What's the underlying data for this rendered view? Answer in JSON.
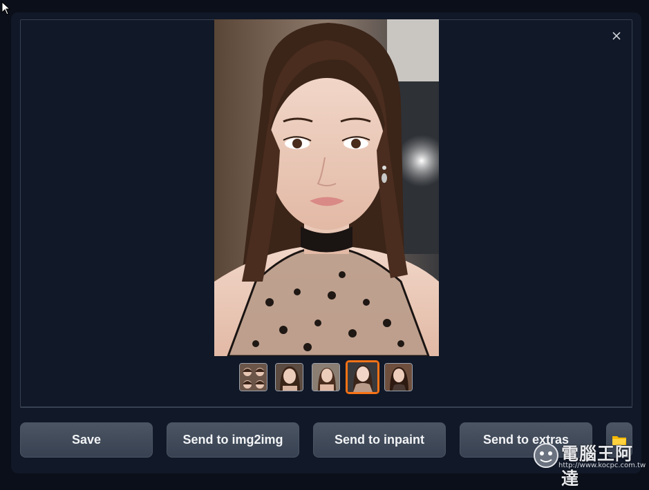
{
  "gallery": {
    "close_label": "close",
    "thumbnails": [
      {
        "name": "thumbnail-1",
        "selected": false
      },
      {
        "name": "thumbnail-2",
        "selected": false
      },
      {
        "name": "thumbnail-3",
        "selected": false
      },
      {
        "name": "thumbnail-4",
        "selected": true
      },
      {
        "name": "thumbnail-5",
        "selected": false
      }
    ]
  },
  "actions": {
    "save": "Save",
    "send_img2img": "Send to img2img",
    "send_inpaint": "Send to inpaint",
    "send_extras": "Send to extras",
    "open_folder_icon": "folder-icon"
  },
  "watermark": {
    "text": "電腦王阿達",
    "url": "http://www.kocpc.com.tw"
  },
  "colors": {
    "background": "#0b0f19",
    "panel": "#111827",
    "border": "#374151",
    "button": "#4b5563",
    "selected_accent": "#f97316"
  }
}
